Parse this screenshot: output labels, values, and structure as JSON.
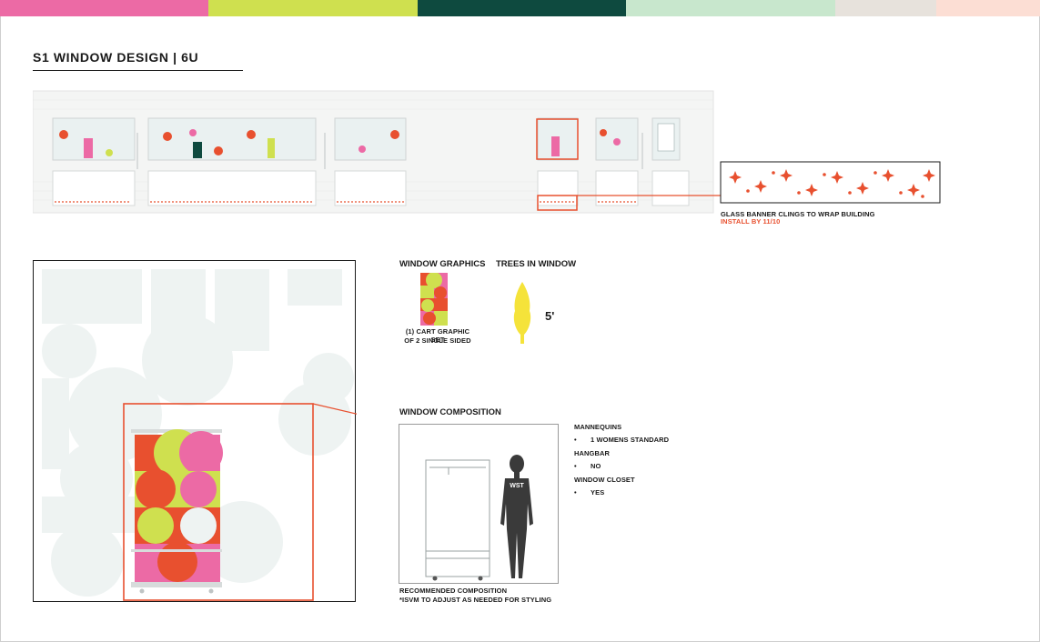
{
  "colors": {
    "accent": "#e8502f",
    "strip": [
      "#ec6aa5",
      "#cfe04f",
      "#0e4a3f",
      "#c8e7cd",
      "#e7e2dc",
      "#fcded4"
    ]
  },
  "title": "S1 WINDOW DESIGN | 6U",
  "banner": {
    "line1": "GLASS BANNER CLINGS TO WRAP BUILDING",
    "line2": "INSTALL BY 11/10"
  },
  "window_graphics": {
    "heading": "WINDOW GRAPHICS",
    "caption_line1": "(1) CART GRAPHIC SET",
    "caption_line2": "OF 2 SINGLE SIDED"
  },
  "trees": {
    "heading": "TREES IN WINDOW",
    "height": "5'"
  },
  "composition": {
    "heading": "WINDOW COMPOSITION",
    "mannequin_label": "WST",
    "caption_line1": "RECOMMENDED COMPOSITION",
    "caption_line2": "*ISVM TO ADJUST AS NEEDED FOR STYLING"
  },
  "specs": {
    "mannequins_label": "MANNEQUINS",
    "mannequins_value": "1 WOMENS STANDARD",
    "hangbar_label": "HANGBAR",
    "hangbar_value": "NO",
    "closet_label": "WINDOW CLOSET",
    "closet_value": "YES",
    "bullet": "•"
  }
}
